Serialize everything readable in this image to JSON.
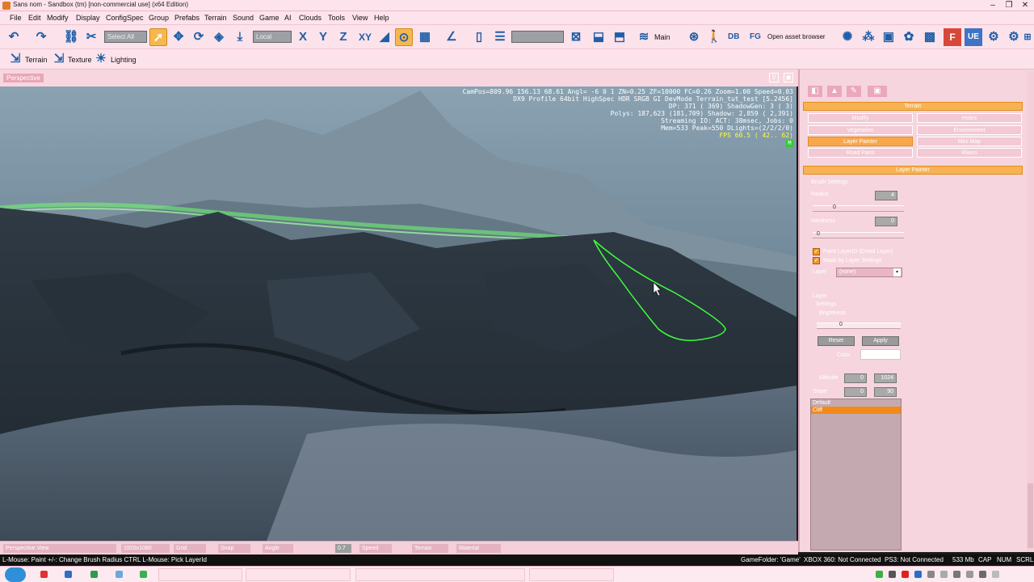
{
  "window": {
    "title": "Sans nom - Sandbox (tm) [non-commercial use] (x64 Edition)",
    "controls": [
      "–",
      "❐",
      "✕"
    ]
  },
  "menu": [
    "File",
    "Edit",
    "Modify",
    "Display",
    "ConfigSpec",
    "Group",
    "Prefabs",
    "Terrain",
    "Sound",
    "Game",
    "AI",
    "Clouds",
    "Tools",
    "View",
    "Help"
  ],
  "toolbar": {
    "select_all": "Select All",
    "coord_system": "Local",
    "axis_x": "X",
    "axis_y": "Y",
    "axis_z": "Z",
    "axis_xy": "XY",
    "layer_label": "Main",
    "db_label": "DB",
    "fg_label": "FG",
    "open_asset_browser": "Open asset browser"
  },
  "toolbar2": {
    "terrain": "Terrain",
    "texture": "Texture",
    "lighting": "Lighting"
  },
  "viewport": {
    "tab": "Perspective",
    "hud": [
      "CamPos=809.96 156.13 68.61 Angl=  -6  0    1 ZN=0.25 ZF=10000 FC=0.26 Zoom=1.00 Speed=0.03",
      "DX9 Profile 64bit HighSpec HDR SRGB GI DevMode Terrain_tut_test [5.2456]",
      "DP: 371 ( 369) ShadowGen: 3 ( 3)",
      "Polys: 187,623 (181,709) Shadow: 2,859 ( 2,391)",
      "Streaming IO: ACT: 38msec, Jobs: 0",
      "Mem=533 Peak=550 DLights=(2/2/2/0)"
    ],
    "fps": "FPS  60.5 ( 42.. 62)",
    "hud_badge": "M"
  },
  "panel": {
    "section_header": "Terrain",
    "buttons": [
      {
        "label": "Modify",
        "active": false
      },
      {
        "label": "Holes",
        "active": false
      },
      {
        "label": "Vegetation",
        "active": false
      },
      {
        "label": "Environment",
        "active": false
      },
      {
        "label": "Layer Painter",
        "active": true
      },
      {
        "label": "Mini Map",
        "active": false
      },
      {
        "label": "Road Paint",
        "active": false
      },
      {
        "label": "Rivers",
        "active": false
      }
    ],
    "rollup_header": "Layer Painter",
    "brush_settings": "Brush Settings",
    "radius_label": "Radius",
    "radius_value": "4",
    "radius_slider": "0",
    "hardness_label": "Hardness",
    "hardness_value": "0",
    "hardness_slider": "0",
    "paint_layer_id": "Paint LayerID (Detail Layer)",
    "mask_by_layer": "Mask by Layer Settings",
    "layer_label": "Layer",
    "layer_value": "(none)",
    "layer_group": "Layer",
    "layer_settings": "Settings",
    "brightness_label": "Brightness",
    "brightness_slider": "0",
    "reset": "Reset",
    "apply": "Apply",
    "color_label": "Color",
    "altitude_label": "Altitude",
    "altitude_min": "0",
    "altitude_max": "1024",
    "slope_label": "Slope",
    "slope_min": "0",
    "slope_max": "90",
    "list_items": [
      {
        "label": "Default",
        "selected": false
      },
      {
        "label": "Cliff",
        "selected": true
      }
    ]
  },
  "viewport_footer": [
    "Perspective View",
    "1920x1080",
    "Grid",
    "Snap",
    "Angle",
    "0.7",
    "Speed",
    "Terrain",
    "Material"
  ],
  "statusbar": {
    "left": "L-Mouse: Paint  +/-: Change Brush Radius  CTRL L-Mouse: Pick LayerId",
    "gamefolder": "GameFolder: 'Game'",
    "xbox": "XBOX 360: Not Connected",
    "ps3": "PS3: Not Connected",
    "mem": "533 Mb",
    "cap": "CAP",
    "num": "NUM",
    "scrl": "SCRL"
  },
  "colors": {
    "accent_orange": "#f7a84a",
    "chrome_pink": "#fce2ea",
    "toolbar_icon_blue": "#1f5fa8",
    "selection_green": "#3dff3d",
    "fps_yellow": "#ffff40"
  }
}
